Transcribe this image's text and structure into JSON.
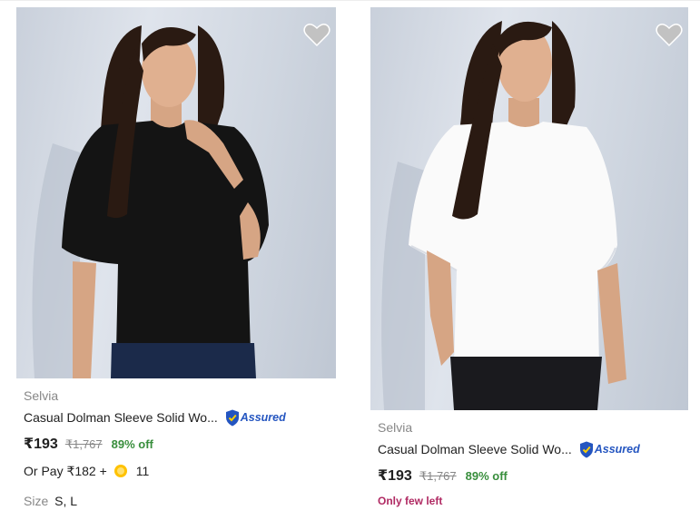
{
  "products": [
    {
      "brand": "Selvia",
      "title": "Casual Dolman Sleeve Solid Wo...",
      "assured_label": "Assured",
      "price": "₹193",
      "mrp": "₹1,767",
      "discount": "89% off",
      "pay_prefix": "Or Pay ₹182 +",
      "coins": "11",
      "size_label": "Size",
      "sizes": "S, L",
      "wishlist_icon": "heart-icon",
      "top_color": "#141414"
    },
    {
      "brand": "Selvia",
      "title": "Casual Dolman Sleeve Solid Wo...",
      "assured_label": "Assured",
      "price": "₹193",
      "mrp": "₹1,767",
      "discount": "89% off",
      "stock_note": "Only few left",
      "wishlist_icon": "heart-icon",
      "top_color": "#fafafa"
    }
  ],
  "colors": {
    "discount_green": "#388e3c",
    "assured_blue": "#2455c0",
    "stock_note": "#b02a63",
    "muted": "#878787"
  }
}
